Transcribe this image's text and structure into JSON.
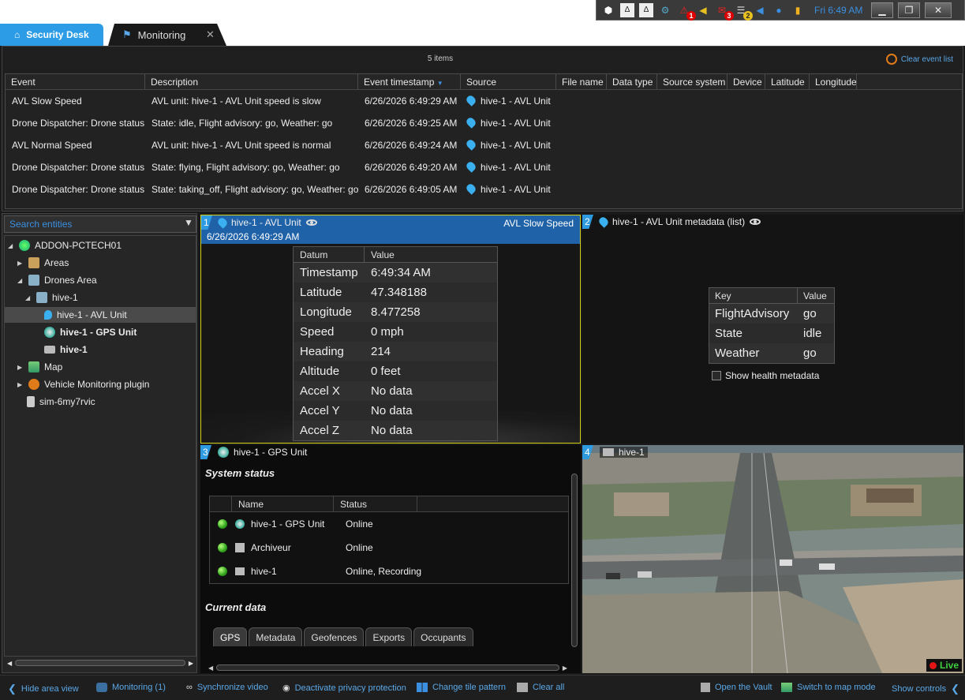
{
  "system_tray": {
    "clock": "Fri 6:49 AM",
    "badges": {
      "alarms": "1",
      "messages": "3",
      "storage": "2"
    },
    "window_buttons": {
      "minimize": "▁",
      "restore": "❐",
      "close": "✕"
    }
  },
  "tabs": {
    "security_desk": "Security Desk",
    "monitoring": "Monitoring",
    "close_glyph": "✕"
  },
  "event_list": {
    "items_count": "5 items",
    "clear_label": "Clear event list",
    "columns": [
      "Event",
      "Description",
      "Event timestamp",
      "Source",
      "File name",
      "Data type",
      "Source system",
      "Device",
      "Latitude",
      "Longitude"
    ],
    "sort_indicator": "▼",
    "rows": [
      {
        "event": "AVL Slow Speed",
        "description": "AVL unit: hive-1 - AVL Unit speed is slow",
        "timestamp": "6/26/2026 6:49:29 AM",
        "source": "hive-1 - AVL Unit"
      },
      {
        "event": "Drone Dispatcher: Drone status",
        "description": "State: idle, Flight advisory: go, Weather: go",
        "timestamp": "6/26/2026 6:49:25 AM",
        "source": "hive-1 - AVL Unit"
      },
      {
        "event": "AVL Normal Speed",
        "description": "AVL unit: hive-1 - AVL Unit speed is normal",
        "timestamp": "6/26/2026 6:49:24 AM",
        "source": "hive-1 - AVL Unit"
      },
      {
        "event": "Drone Dispatcher: Drone status",
        "description": "State: flying, Flight advisory: go, Weather: go",
        "timestamp": "6/26/2026 6:49:20 AM",
        "source": "hive-1 - AVL Unit"
      },
      {
        "event": "Drone Dispatcher: Drone status",
        "description": "State: taking_off, Flight advisory: go, Weather: go",
        "timestamp": "6/26/2026 6:49:05 AM",
        "source": "hive-1 - AVL Unit"
      }
    ]
  },
  "area_view": {
    "search_placeholder": "Search entities",
    "nodes": [
      {
        "label": "ADDON-PCTECH01"
      },
      {
        "label": "Areas"
      },
      {
        "label": "Drones Area"
      },
      {
        "label": "hive-1"
      },
      {
        "label": "hive-1 - AVL Unit"
      },
      {
        "label": "hive-1 - GPS Unit"
      },
      {
        "label": "hive-1"
      },
      {
        "label": "Map"
      },
      {
        "label": "Vehicle Monitoring plugin"
      },
      {
        "label": "sim-6my7rvic"
      }
    ]
  },
  "tile1": {
    "number": "1",
    "title": "hive-1 - AVL Unit",
    "event": "AVL Slow Speed",
    "timestamp": "6/26/2026 6:49:29 AM",
    "headers": [
      "Datum",
      "Value"
    ],
    "rows": [
      {
        "datum": "Timestamp",
        "value": "6:49:34 AM"
      },
      {
        "datum": "Latitude",
        "value": "47.348188"
      },
      {
        "datum": "Longitude",
        "value": "8.477258"
      },
      {
        "datum": "Speed",
        "value": "0 mph"
      },
      {
        "datum": "Heading",
        "value": "214"
      },
      {
        "datum": "Altitude",
        "value": "0 feet"
      },
      {
        "datum": "Accel X",
        "value": "No data"
      },
      {
        "datum": "Accel Y",
        "value": "No data"
      },
      {
        "datum": "Accel Z",
        "value": "No data"
      }
    ]
  },
  "tile2": {
    "number": "2",
    "title": "hive-1 - AVL Unit metadata (list)",
    "headers": [
      "Key",
      "Value"
    ],
    "rows": [
      {
        "key": "FlightAdvisory",
        "value": "go"
      },
      {
        "key": "State",
        "value": "idle"
      },
      {
        "key": "Weather",
        "value": "go"
      }
    ],
    "show_health": "Show health metadata"
  },
  "tile3": {
    "number": "3",
    "title": "hive-1 - GPS Unit",
    "system_status": "System status",
    "headers": [
      "Name",
      "Status"
    ],
    "rows": [
      {
        "name": "hive-1 - GPS Unit",
        "status": "Online"
      },
      {
        "name": "Archiveur",
        "status": "Online"
      },
      {
        "name": "hive-1",
        "status": "Online, Recording"
      }
    ],
    "current_data": "Current data",
    "subtabs": [
      "GPS",
      "Metadata",
      "Geofences",
      "Exports",
      "Occupants"
    ]
  },
  "tile4": {
    "number": "4",
    "title": "hive-1",
    "live": "Live"
  },
  "bottom_bar": {
    "hide_area": "Hide area view",
    "monitoring": "Monitoring (1)",
    "sync": "Synchronize video",
    "privacy": "Deactivate privacy protection",
    "tile_pattern": "Change tile pattern",
    "clear_all": "Clear all",
    "vault": "Open the Vault",
    "map_mode": "Switch to map mode",
    "show_controls": "Show controls"
  },
  "colors": {
    "accent_blue": "#2c9ce6",
    "tile_header": "#1f62a8",
    "selected_tile_border": "#d4d01a",
    "live_green": "#3fcf3f",
    "link_blue": "#5aa8e8"
  }
}
